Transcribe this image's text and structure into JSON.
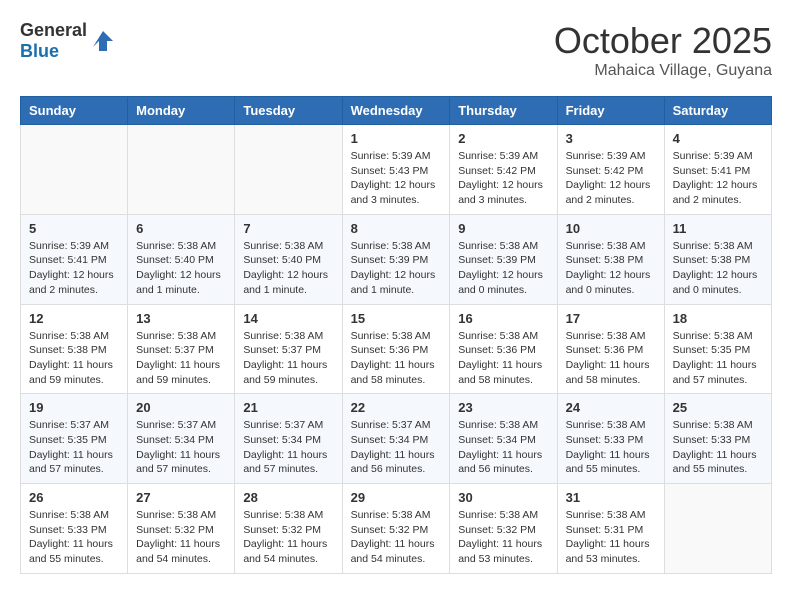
{
  "header": {
    "logo_general": "General",
    "logo_blue": "Blue",
    "month": "October 2025",
    "location": "Mahaica Village, Guyana"
  },
  "weekdays": [
    "Sunday",
    "Monday",
    "Tuesday",
    "Wednesday",
    "Thursday",
    "Friday",
    "Saturday"
  ],
  "weeks": [
    [
      {
        "day": "",
        "sunrise": "",
        "sunset": "",
        "daylight": ""
      },
      {
        "day": "",
        "sunrise": "",
        "sunset": "",
        "daylight": ""
      },
      {
        "day": "",
        "sunrise": "",
        "sunset": "",
        "daylight": ""
      },
      {
        "day": "1",
        "sunrise": "Sunrise: 5:39 AM",
        "sunset": "Sunset: 5:43 PM",
        "daylight": "Daylight: 12 hours and 3 minutes."
      },
      {
        "day": "2",
        "sunrise": "Sunrise: 5:39 AM",
        "sunset": "Sunset: 5:42 PM",
        "daylight": "Daylight: 12 hours and 3 minutes."
      },
      {
        "day": "3",
        "sunrise": "Sunrise: 5:39 AM",
        "sunset": "Sunset: 5:42 PM",
        "daylight": "Daylight: 12 hours and 2 minutes."
      },
      {
        "day": "4",
        "sunrise": "Sunrise: 5:39 AM",
        "sunset": "Sunset: 5:41 PM",
        "daylight": "Daylight: 12 hours and 2 minutes."
      }
    ],
    [
      {
        "day": "5",
        "sunrise": "Sunrise: 5:39 AM",
        "sunset": "Sunset: 5:41 PM",
        "daylight": "Daylight: 12 hours and 2 minutes."
      },
      {
        "day": "6",
        "sunrise": "Sunrise: 5:38 AM",
        "sunset": "Sunset: 5:40 PM",
        "daylight": "Daylight: 12 hours and 1 minute."
      },
      {
        "day": "7",
        "sunrise": "Sunrise: 5:38 AM",
        "sunset": "Sunset: 5:40 PM",
        "daylight": "Daylight: 12 hours and 1 minute."
      },
      {
        "day": "8",
        "sunrise": "Sunrise: 5:38 AM",
        "sunset": "Sunset: 5:39 PM",
        "daylight": "Daylight: 12 hours and 1 minute."
      },
      {
        "day": "9",
        "sunrise": "Sunrise: 5:38 AM",
        "sunset": "Sunset: 5:39 PM",
        "daylight": "Daylight: 12 hours and 0 minutes."
      },
      {
        "day": "10",
        "sunrise": "Sunrise: 5:38 AM",
        "sunset": "Sunset: 5:38 PM",
        "daylight": "Daylight: 12 hours and 0 minutes."
      },
      {
        "day": "11",
        "sunrise": "Sunrise: 5:38 AM",
        "sunset": "Sunset: 5:38 PM",
        "daylight": "Daylight: 12 hours and 0 minutes."
      }
    ],
    [
      {
        "day": "12",
        "sunrise": "Sunrise: 5:38 AM",
        "sunset": "Sunset: 5:38 PM",
        "daylight": "Daylight: 11 hours and 59 minutes."
      },
      {
        "day": "13",
        "sunrise": "Sunrise: 5:38 AM",
        "sunset": "Sunset: 5:37 PM",
        "daylight": "Daylight: 11 hours and 59 minutes."
      },
      {
        "day": "14",
        "sunrise": "Sunrise: 5:38 AM",
        "sunset": "Sunset: 5:37 PM",
        "daylight": "Daylight: 11 hours and 59 minutes."
      },
      {
        "day": "15",
        "sunrise": "Sunrise: 5:38 AM",
        "sunset": "Sunset: 5:36 PM",
        "daylight": "Daylight: 11 hours and 58 minutes."
      },
      {
        "day": "16",
        "sunrise": "Sunrise: 5:38 AM",
        "sunset": "Sunset: 5:36 PM",
        "daylight": "Daylight: 11 hours and 58 minutes."
      },
      {
        "day": "17",
        "sunrise": "Sunrise: 5:38 AM",
        "sunset": "Sunset: 5:36 PM",
        "daylight": "Daylight: 11 hours and 58 minutes."
      },
      {
        "day": "18",
        "sunrise": "Sunrise: 5:38 AM",
        "sunset": "Sunset: 5:35 PM",
        "daylight": "Daylight: 11 hours and 57 minutes."
      }
    ],
    [
      {
        "day": "19",
        "sunrise": "Sunrise: 5:37 AM",
        "sunset": "Sunset: 5:35 PM",
        "daylight": "Daylight: 11 hours and 57 minutes."
      },
      {
        "day": "20",
        "sunrise": "Sunrise: 5:37 AM",
        "sunset": "Sunset: 5:34 PM",
        "daylight": "Daylight: 11 hours and 57 minutes."
      },
      {
        "day": "21",
        "sunrise": "Sunrise: 5:37 AM",
        "sunset": "Sunset: 5:34 PM",
        "daylight": "Daylight: 11 hours and 57 minutes."
      },
      {
        "day": "22",
        "sunrise": "Sunrise: 5:37 AM",
        "sunset": "Sunset: 5:34 PM",
        "daylight": "Daylight: 11 hours and 56 minutes."
      },
      {
        "day": "23",
        "sunrise": "Sunrise: 5:38 AM",
        "sunset": "Sunset: 5:34 PM",
        "daylight": "Daylight: 11 hours and 56 minutes."
      },
      {
        "day": "24",
        "sunrise": "Sunrise: 5:38 AM",
        "sunset": "Sunset: 5:33 PM",
        "daylight": "Daylight: 11 hours and 55 minutes."
      },
      {
        "day": "25",
        "sunrise": "Sunrise: 5:38 AM",
        "sunset": "Sunset: 5:33 PM",
        "daylight": "Daylight: 11 hours and 55 minutes."
      }
    ],
    [
      {
        "day": "26",
        "sunrise": "Sunrise: 5:38 AM",
        "sunset": "Sunset: 5:33 PM",
        "daylight": "Daylight: 11 hours and 55 minutes."
      },
      {
        "day": "27",
        "sunrise": "Sunrise: 5:38 AM",
        "sunset": "Sunset: 5:32 PM",
        "daylight": "Daylight: 11 hours and 54 minutes."
      },
      {
        "day": "28",
        "sunrise": "Sunrise: 5:38 AM",
        "sunset": "Sunset: 5:32 PM",
        "daylight": "Daylight: 11 hours and 54 minutes."
      },
      {
        "day": "29",
        "sunrise": "Sunrise: 5:38 AM",
        "sunset": "Sunset: 5:32 PM",
        "daylight": "Daylight: 11 hours and 54 minutes."
      },
      {
        "day": "30",
        "sunrise": "Sunrise: 5:38 AM",
        "sunset": "Sunset: 5:32 PM",
        "daylight": "Daylight: 11 hours and 53 minutes."
      },
      {
        "day": "31",
        "sunrise": "Sunrise: 5:38 AM",
        "sunset": "Sunset: 5:31 PM",
        "daylight": "Daylight: 11 hours and 53 minutes."
      },
      {
        "day": "",
        "sunrise": "",
        "sunset": "",
        "daylight": ""
      }
    ]
  ]
}
